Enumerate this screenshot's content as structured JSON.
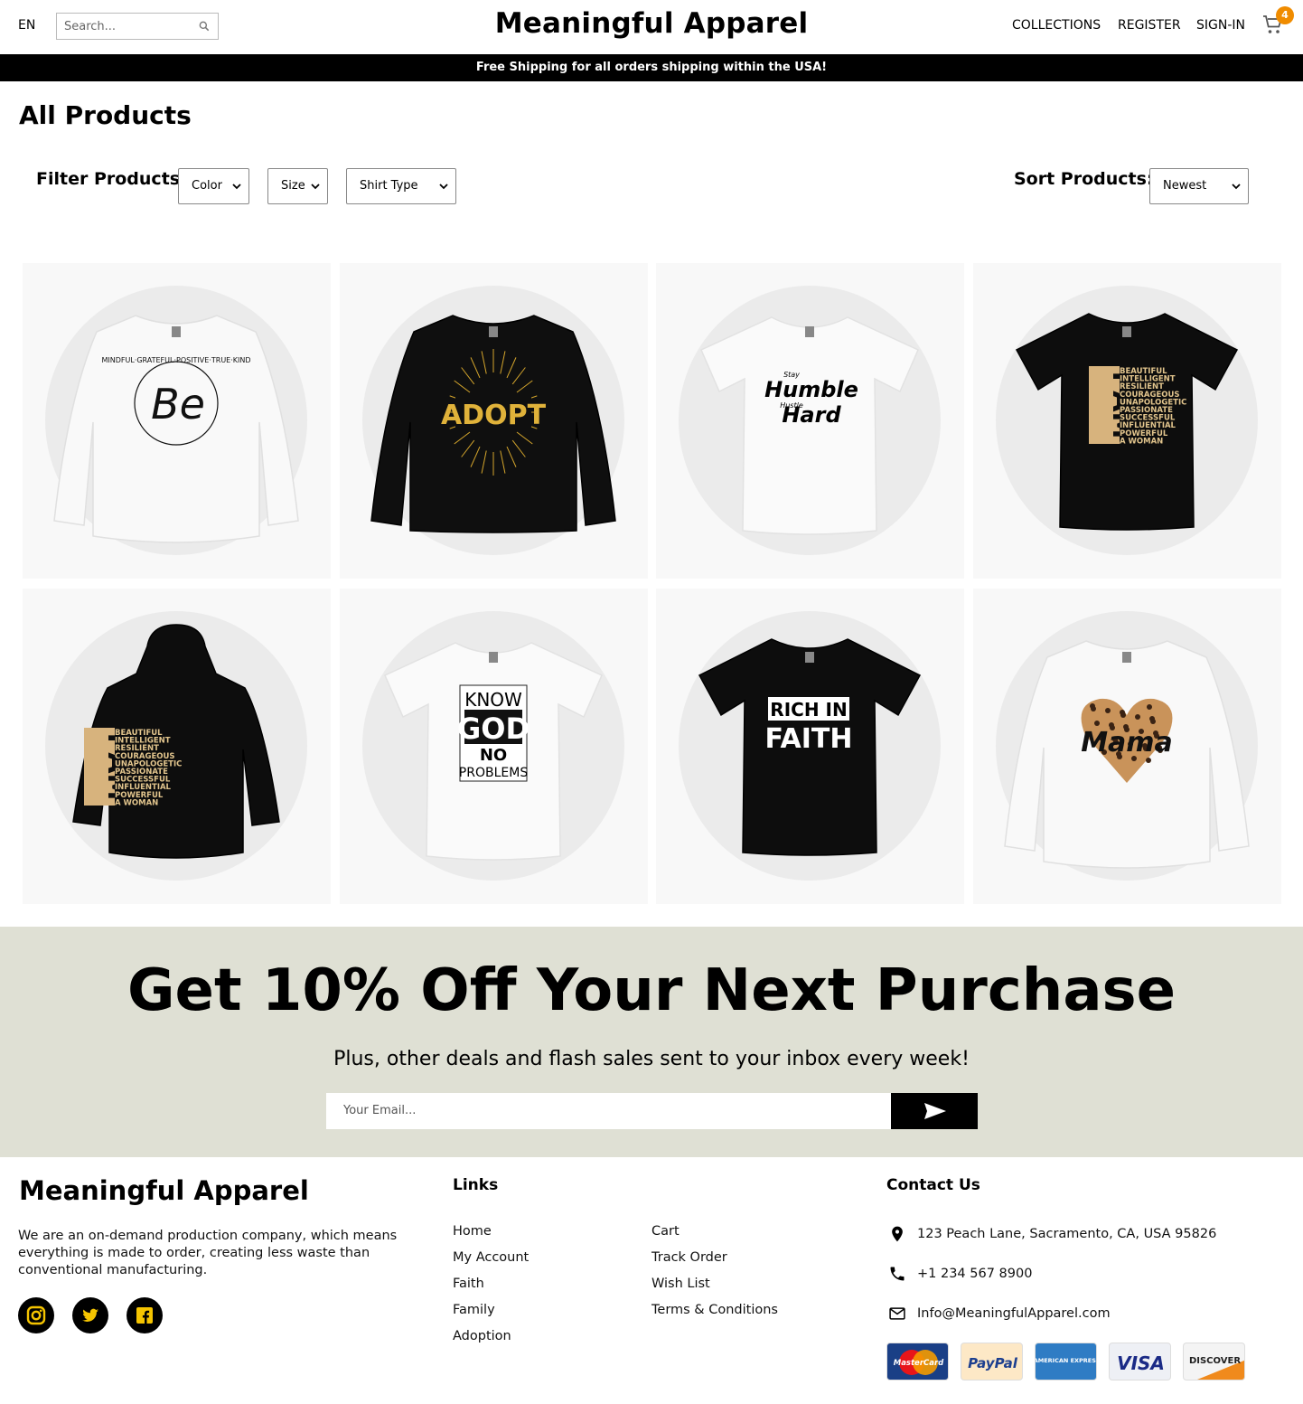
{
  "header": {
    "language": "EN",
    "search_placeholder": "Search...",
    "brand": "Meaningful Apparel",
    "nav": {
      "collections": "COLLECTIONS",
      "register": "REGISTER",
      "signin": "SIGN-IN"
    },
    "cart_count": "4",
    "accent_color": "#f08c00"
  },
  "promo": "Free Shipping for all orders shipping within the USA!",
  "page_title": "All Products",
  "filters": {
    "label": "Filter Products:",
    "color": "Color",
    "size": "Size",
    "shirt_type": "Shirt Type"
  },
  "sort": {
    "label": "Sort Products:",
    "value": "Newest"
  },
  "products": [
    {
      "garment": "white-sweatshirt",
      "print": [
        "MINDFUL·GRATEFUL·POSITIVE·TRUE·KIND",
        "Be"
      ]
    },
    {
      "garment": "black-sweatshirt",
      "print": [
        "ADOPT"
      ]
    },
    {
      "garment": "white-tshirt",
      "print": [
        "Stay",
        "Humble",
        "Hustle",
        "Hard"
      ]
    },
    {
      "garment": "black-tshirt",
      "print": [
        "I AM",
        "BEAUTIFUL",
        "INTELLIGENT",
        "RESILIENT",
        "COURAGEOUS",
        "UNAPOLOGETIC",
        "PASSIONATE",
        "SUCCESSFUL",
        "INFLUENTIAL",
        "POWERFUL",
        "A WOMAN"
      ]
    },
    {
      "garment": "black-hoodie",
      "print": [
        "I AM",
        "BEAUTIFUL",
        "INTELLIGENT",
        "RESILIENT",
        "COURAGEOUS",
        "UNAPOLOGETIC",
        "PASSIONATE",
        "SUCCESSFUL",
        "INFLUENTIAL",
        "POWERFUL",
        "A WOMAN"
      ]
    },
    {
      "garment": "white-tshirt",
      "print": [
        "KNOW",
        "GOD",
        "NO",
        "PROBLEMS"
      ]
    },
    {
      "garment": "black-tshirt",
      "print": [
        "RICH IN",
        "FAITH"
      ]
    },
    {
      "garment": "white-sweatshirt",
      "print": [
        "Mama"
      ]
    }
  ],
  "newsletter": {
    "title": "Get 10% Off Your Next Purchase",
    "subtitle": "Plus, other deals and flash sales sent to your inbox every week!",
    "email_placeholder": "Your Email...",
    "bg_color": "#dfe0d4"
  },
  "footer": {
    "brand": "Meaningful Apparel",
    "description": "We are an on-demand production company, which means everything is made to order, creating less waste than conventional manufacturing.",
    "social": [
      "instagram-icon",
      "twitter-icon",
      "facebook-icon"
    ],
    "social_color": "#f5c400",
    "links_heading": "Links",
    "links_col1": [
      "Home",
      "My Account",
      "Faith",
      "Family",
      "Adoption"
    ],
    "links_col2": [
      "Cart",
      "Track Order",
      "Wish List",
      "Terms & Conditions"
    ],
    "contact_heading": "Contact Us",
    "address": "123 Peach Lane, Sacramento, CA, USA 95826",
    "phone": "+1 234 567 8900",
    "email": "Info@MeaningfulApparel.com",
    "payments": [
      "MasterCard",
      "PayPal",
      "AMERICAN EXPRESS",
      "VISA",
      "DISCOVER"
    ]
  }
}
